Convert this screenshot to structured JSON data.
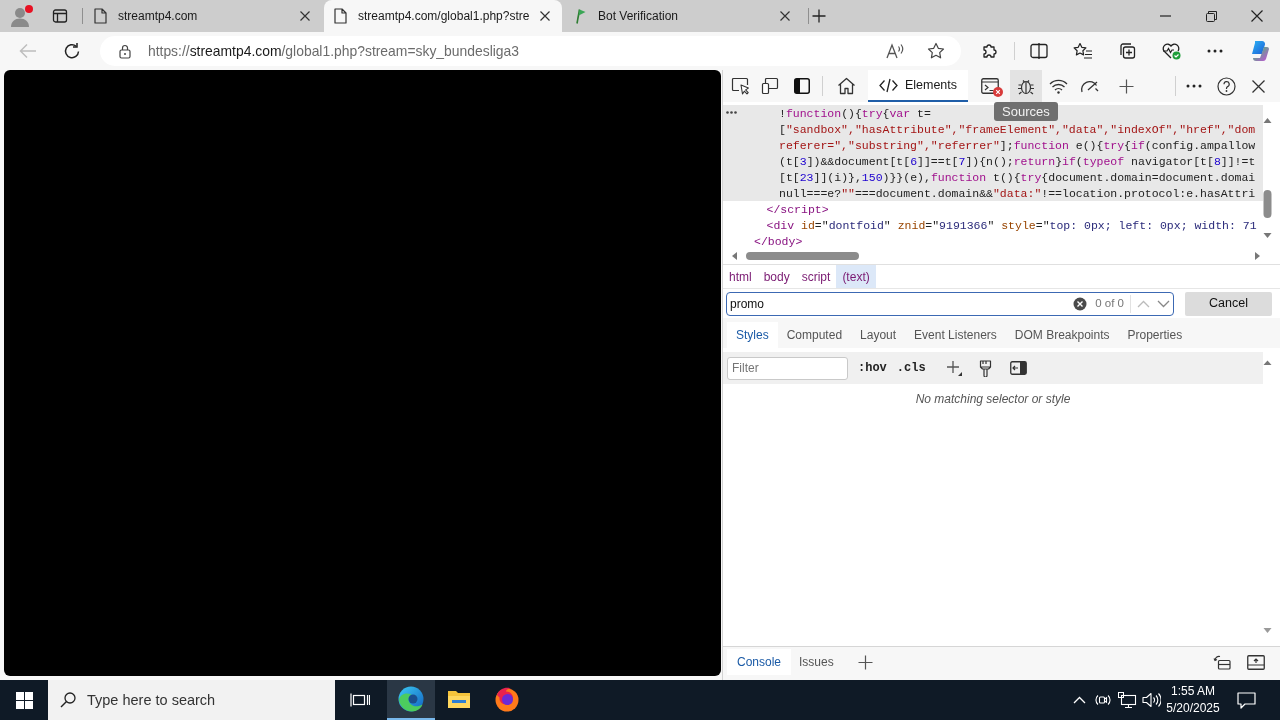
{
  "browser_tabs": [
    {
      "kind": "document",
      "title": "streamtp4.com",
      "selected": false
    },
    {
      "kind": "document",
      "title": "streamtp4.com/global1.php?stre",
      "selected": true
    },
    {
      "kind": "flag",
      "title": "Bot Verification",
      "selected": false
    }
  ],
  "address_bar": {
    "scheme": "https://",
    "host": "streamtp4.com",
    "path": "/global1.php?stream=sky_bundesliga3"
  },
  "devtools": {
    "toolbar_tabs": [
      {
        "label": "Elements",
        "selected": true
      }
    ],
    "console_errors": true,
    "tooltip": "Sources",
    "dom_tree": {
      "children": [
        {
          "children": [
            {
              "selected": true,
              "lines": [
                [
                  {
                    "kind": "plain",
                    "text": "!"
                  },
                  {
                    "kind": "keyword",
                    "text": "function"
                  },
                  {
                    "kind": "plain",
                    "text": "(){"
                  },
                  {
                    "kind": "keyword",
                    "text": "try"
                  },
                  {
                    "kind": "plain",
                    "text": "{"
                  },
                  {
                    "kind": "keyword",
                    "text": "var"
                  },
                  {
                    "kind": "plain",
                    "text": " t="
                  }
                ],
                [
                  {
                    "kind": "plain",
                    "text": "["
                  },
                  {
                    "kind": "string",
                    "text": "\"sandbox\",\"hasAttribute\",\"frameElement\",\"data\",\"indexOf\",\"href\",\"dom"
                  }
                ],
                [
                  {
                    "kind": "string",
                    "text": "referer=\",\"substring\",\"referrer\""
                  },
                  {
                    "kind": "plain",
                    "text": "];"
                  },
                  {
                    "kind": "keyword",
                    "text": "function"
                  },
                  {
                    "kind": "plain",
                    "text": " e(){"
                  },
                  {
                    "kind": "keyword",
                    "text": "try"
                  },
                  {
                    "kind": "plain",
                    "text": "{"
                  },
                  {
                    "kind": "keyword",
                    "text": "if"
                  },
                  {
                    "kind": "plain",
                    "text": "(config.ampallow"
                  }
                ],
                [
                  {
                    "kind": "plain",
                    "text": "(t["
                  },
                  {
                    "kind": "number",
                    "text": "3"
                  },
                  {
                    "kind": "plain",
                    "text": "])&&document[t["
                  },
                  {
                    "kind": "number",
                    "text": "6"
                  },
                  {
                    "kind": "plain",
                    "text": "]]==t["
                  },
                  {
                    "kind": "number",
                    "text": "7"
                  },
                  {
                    "kind": "plain",
                    "text": "]){n();"
                  },
                  {
                    "kind": "keyword",
                    "text": "return"
                  },
                  {
                    "kind": "plain",
                    "text": "}"
                  },
                  {
                    "kind": "keyword",
                    "text": "if"
                  },
                  {
                    "kind": "plain",
                    "text": "("
                  },
                  {
                    "kind": "keyword",
                    "text": "typeof"
                  },
                  {
                    "kind": "plain",
                    "text": " navigator[t["
                  },
                  {
                    "kind": "number",
                    "text": "8"
                  },
                  {
                    "kind": "plain",
                    "text": "]]!=t"
                  }
                ],
                [
                  {
                    "kind": "plain",
                    "text": "[t["
                  },
                  {
                    "kind": "number",
                    "text": "23"
                  },
                  {
                    "kind": "plain",
                    "text": "]](i)},"
                  },
                  {
                    "kind": "number",
                    "text": "150"
                  },
                  {
                    "kind": "plain",
                    "text": ")}}(e),"
                  },
                  {
                    "kind": "keyword",
                    "text": "function"
                  },
                  {
                    "kind": "plain",
                    "text": " t(){"
                  },
                  {
                    "kind": "keyword",
                    "text": "try"
                  },
                  {
                    "kind": "plain",
                    "text": "{document.domain=document.domai"
                  }
                ],
                [
                  {
                    "kind": "plain",
                    "text": "null===e?"
                  },
                  {
                    "kind": "string",
                    "text": "\"\""
                  },
                  {
                    "kind": "plain",
                    "text": "===document.domain&&"
                  },
                  {
                    "kind": "string",
                    "text": "\"data:\""
                  },
                  {
                    "kind": "plain",
                    "text": "!==location.protocol:e.hasAttri"
                  }
                ]
              ]
            }
          ],
          "close": [
            {
              "kind": "tag",
              "text": "</script>"
            }
          ]
        },
        {
          "open": [
            {
              "kind": "tag",
              "text": "<div"
            },
            {
              "kind": "attr",
              "text": " id"
            },
            {
              "kind": "plain",
              "text": "=\""
            },
            {
              "kind": "value",
              "text": "dontfoid"
            },
            {
              "kind": "plain",
              "text": "\" "
            },
            {
              "kind": "attr",
              "text": "znid"
            },
            {
              "kind": "plain",
              "text": "=\""
            },
            {
              "kind": "value",
              "text": "9191366"
            },
            {
              "kind": "plain",
              "text": "\" "
            },
            {
              "kind": "attr",
              "text": "style"
            },
            {
              "kind": "plain",
              "text": "=\""
            },
            {
              "kind": "value",
              "text": "top: 0px; left: 0px; width: 71"
            }
          ]
        }
      ],
      "close": [
        {
          "kind": "tag",
          "text": "</body>"
        }
      ]
    },
    "breadcrumbs": [
      {
        "label": "html",
        "selected": false
      },
      {
        "label": "body",
        "selected": false
      },
      {
        "label": "script",
        "selected": false
      },
      {
        "label": "(text)",
        "selected": true
      }
    ],
    "search": {
      "value": "promo",
      "match_count": "0 of 0",
      "cancel_label": "Cancel"
    },
    "sidebar_tabs": [
      {
        "label": "Styles",
        "selected": true
      },
      {
        "label": "Computed",
        "selected": false
      },
      {
        "label": "Layout",
        "selected": false
      },
      {
        "label": "Event Listeners",
        "selected": false
      },
      {
        "label": "DOM Breakpoints",
        "selected": false
      },
      {
        "label": "Properties",
        "selected": false
      }
    ],
    "filter": {
      "placeholder": "Filter"
    },
    "style_toggles": [
      ":hov",
      ".cls"
    ],
    "empty_message": "No matching selector or style",
    "drawer_tabs": [
      {
        "label": "Console",
        "selected": true
      },
      {
        "label": "Issues",
        "selected": false
      }
    ]
  },
  "taskbar": {
    "search_placeholder": "Type here to search",
    "apps": [
      {
        "kind": "edge",
        "active": true
      },
      {
        "kind": "explorer",
        "active": false
      },
      {
        "kind": "firefox",
        "active": false
      }
    ],
    "time": "1:55 AM",
    "date": "5/20/2025"
  }
}
